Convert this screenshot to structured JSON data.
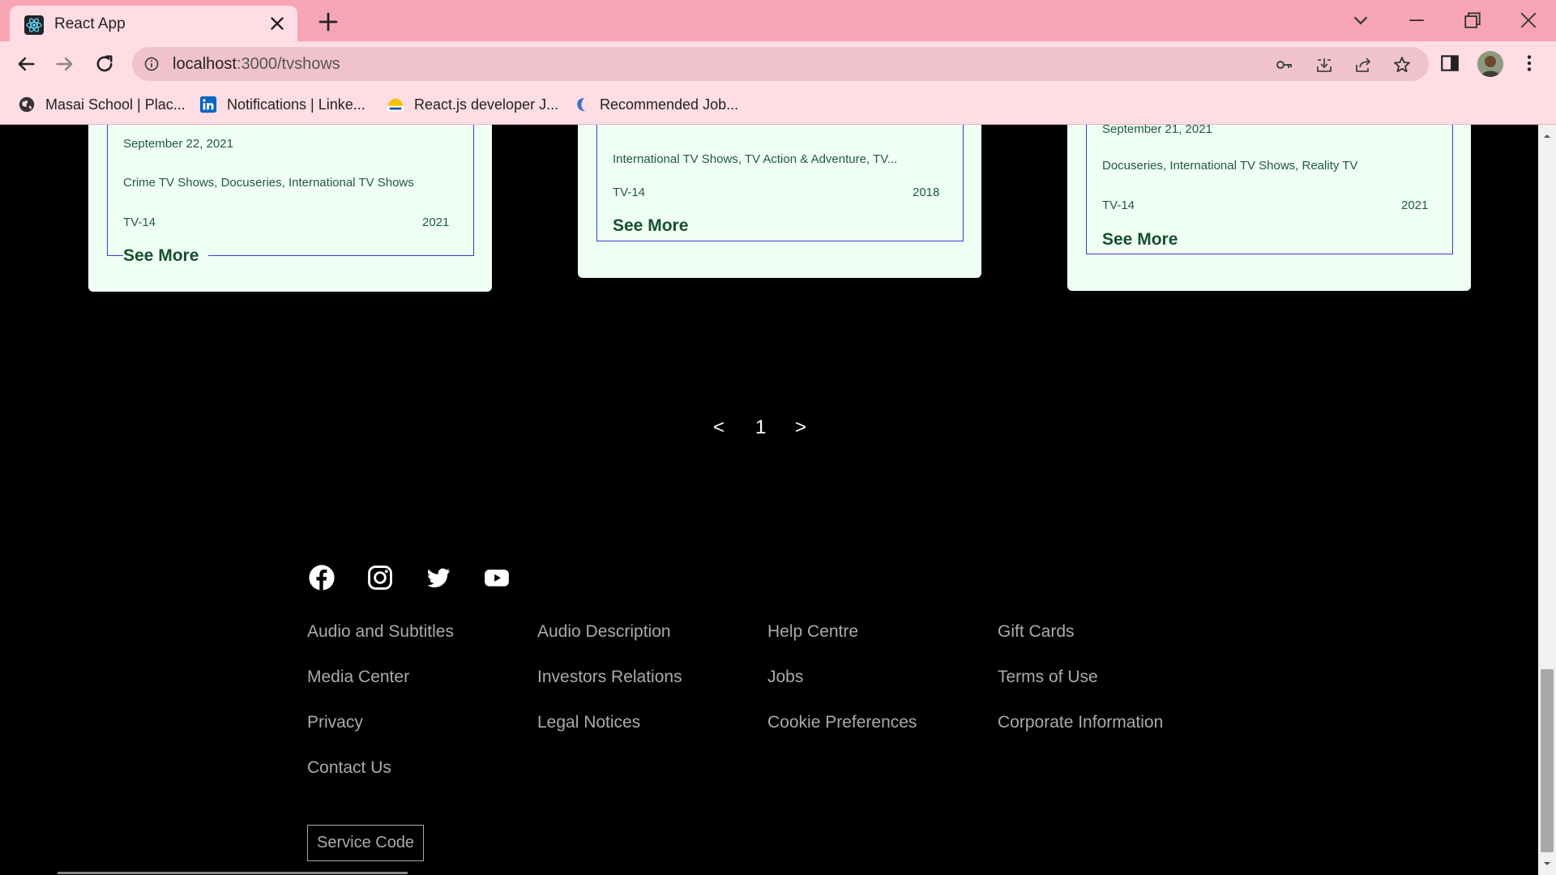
{
  "browser": {
    "tab_title": "React App",
    "url_host": "localhost",
    "url_path": ":3000/tvshows",
    "bookmarks": [
      {
        "label": "Masai School | Plac...",
        "icon": "globe-icon"
      },
      {
        "label": "Notifications | Linke...",
        "icon": "linkedin-icon"
      },
      {
        "label": "React.js developer J...",
        "icon": "shine-icon"
      },
      {
        "label": "Recommended Job...",
        "icon": "naukri-icon"
      }
    ]
  },
  "cards": [
    {
      "date": "September 22, 2021",
      "genres": "Crime TV Shows, Docuseries, International TV Shows",
      "rating": "TV-14",
      "year": "2021",
      "see_more": "See More"
    },
    {
      "date": "",
      "genres": "International TV Shows, TV Action & Adventure, TV...",
      "rating": "TV-14",
      "year": "2018",
      "see_more": "See More"
    },
    {
      "date": "September 21, 2021",
      "genres": "Docuseries, International TV Shows, Reality TV",
      "rating": "TV-14",
      "year": "2021",
      "see_more": "See More"
    }
  ],
  "pagination": {
    "prev": "<",
    "page": "1",
    "next": ">"
  },
  "footer": {
    "social": [
      "facebook-icon",
      "instagram-icon",
      "twitter-icon",
      "youtube-icon"
    ],
    "columns": [
      [
        "Audio and Subtitles",
        "Media Center",
        "Privacy",
        "Contact Us"
      ],
      [
        "Audio Description",
        "Investors Relations",
        "Legal Notices"
      ],
      [
        "Help Centre",
        "Jobs",
        "Cookie Preferences"
      ],
      [
        "Gift Cards",
        "Terms of Use",
        "Corporate Information"
      ]
    ],
    "service_code": "Service Code"
  },
  "colors": {
    "tabbar": "#f7a5b5",
    "chrome": "#ffdde4",
    "card_bg": "#f0fff4",
    "card_text": "#1f5c3a",
    "card_border": "#3a3ad0",
    "footer_link": "#aaaaaa"
  }
}
